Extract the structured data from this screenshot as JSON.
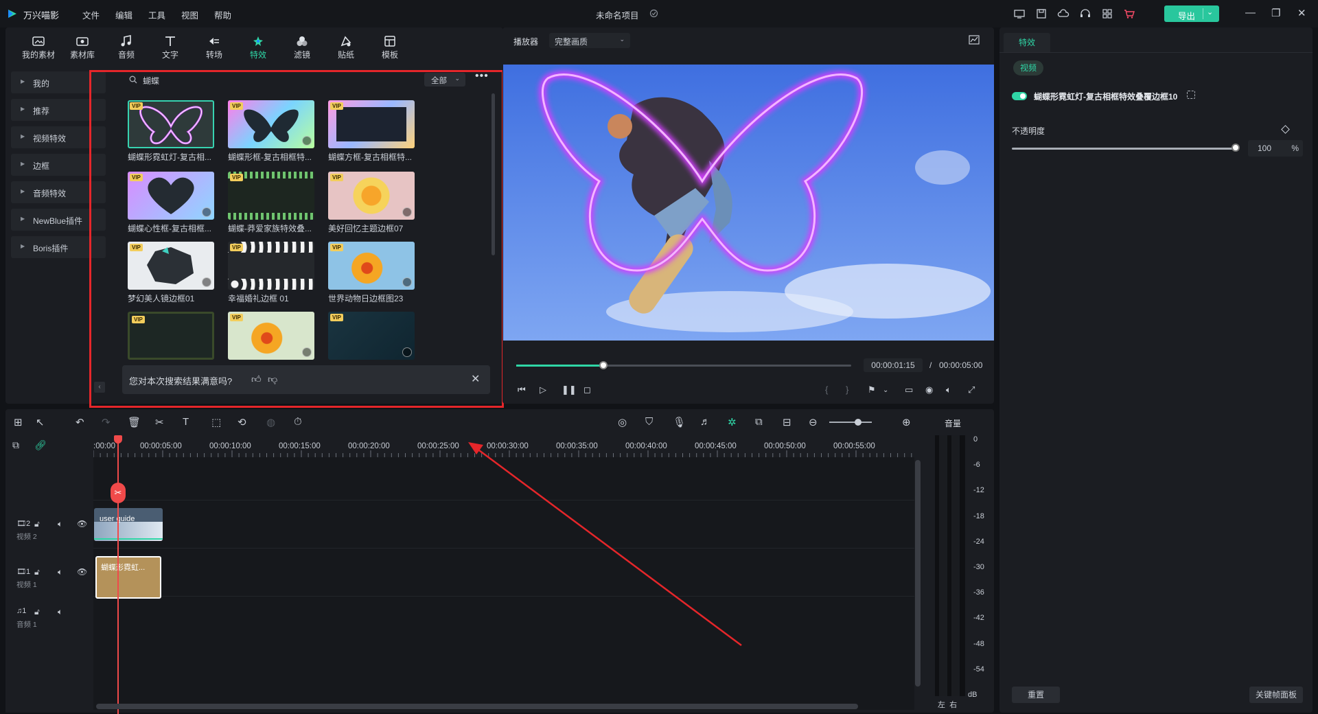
{
  "app": {
    "name": "万兴喵影",
    "project_title": "未命名项目",
    "menu": [
      "文件",
      "编辑",
      "工具",
      "视图",
      "帮助"
    ],
    "export_label": "导出",
    "accent": "#2fd6a6",
    "annotation_color": "#e5262a",
    "title_icons": [
      "monitor-icon",
      "save-icon",
      "cloud-icon",
      "headset-icon",
      "grid-icon",
      "cart-icon"
    ]
  },
  "toolbar": {
    "tabs": [
      {
        "label": "我的素材",
        "icon": "my-media-icon"
      },
      {
        "label": "素材库",
        "icon": "library-icon"
      },
      {
        "label": "音频",
        "icon": "music-icon"
      },
      {
        "label": "文字",
        "icon": "text-icon"
      },
      {
        "label": "转场",
        "icon": "transition-icon"
      },
      {
        "label": "特效",
        "icon": "effects-icon",
        "active": true
      },
      {
        "label": "滤镜",
        "icon": "filter-icon"
      },
      {
        "label": "贴纸",
        "icon": "sticker-icon"
      },
      {
        "label": "模板",
        "icon": "template-icon"
      }
    ]
  },
  "categories": [
    "我的",
    "推荐",
    "视频特效",
    "边框",
    "音频特效",
    "NewBlue插件",
    "Boris插件"
  ],
  "search": {
    "query": "蝴蝶",
    "filter": "全部"
  },
  "results": [
    {
      "title": "蝴蝶形霓虹灯-复古相...",
      "vip": "VIP",
      "selected": true
    },
    {
      "title": "蝴蝶形框-复古相框特...",
      "vip": "VIP"
    },
    {
      "title": "蝴蝶方框-复古相框特...",
      "vip": "VIP"
    },
    {
      "title": "蝴蝶心性框-复古相框...",
      "vip": "VIP"
    },
    {
      "title": "蝴蝶-莽爱家族特效叠...",
      "vip": "VIP"
    },
    {
      "title": "美好回忆主题边框07",
      "vip": "VIP"
    },
    {
      "title": "梦幻美人镜边框01",
      "vip": "VIP"
    },
    {
      "title": "幸福婚礼边框 01",
      "vip": "VIP"
    },
    {
      "title": "世界动物日边框图23",
      "vip": "VIP"
    },
    {
      "title": "",
      "vip": "VIP"
    },
    {
      "title": "",
      "vip": "VIP"
    },
    {
      "title": "",
      "vip": "VIP"
    }
  ],
  "feedback": {
    "question": "您对本次搜索结果满意吗?"
  },
  "player": {
    "label": "播放器",
    "quality": "完整画质",
    "current_time": "00:00:01:15",
    "separator": "/",
    "total_time": "00:00:05:00",
    "progress_percent": 26
  },
  "properties": {
    "tab": "特效",
    "subtab": "视频",
    "effect_name": "蝴蝶形霓虹灯-复古相框特效叠覆边框10",
    "opacity_label": "不透明度",
    "opacity_value": "100",
    "opacity_unit": "%",
    "reset_label": "重置",
    "keyframe_label": "关键帧面板"
  },
  "timeline": {
    "ruler_labels": [
      ":00:00",
      "00:00:05:00",
      "00:00:10:00",
      "00:00:15:00",
      "00:00:20:00",
      "00:00:25:00",
      "00:00:30:00",
      "00:00:35:00",
      "00:00:40:00",
      "00:00:45:00",
      "00:00:50:00",
      "00:00:55:00"
    ],
    "tracks": [
      {
        "num": "2",
        "name": "视频 2"
      },
      {
        "num": "1",
        "name": "视频 1"
      },
      {
        "num": "1",
        "name": "音频 1"
      }
    ],
    "clip_video2": "user guide",
    "clip_video1": "蝴蝶形霓虹...",
    "meter_title": "音量",
    "meter_labels": [
      "0",
      "-6",
      "-12",
      "-18",
      "-24",
      "-30",
      "-36",
      "-42",
      "-48",
      "-54",
      "dB"
    ],
    "left_label": "左",
    "right_label": "右"
  }
}
